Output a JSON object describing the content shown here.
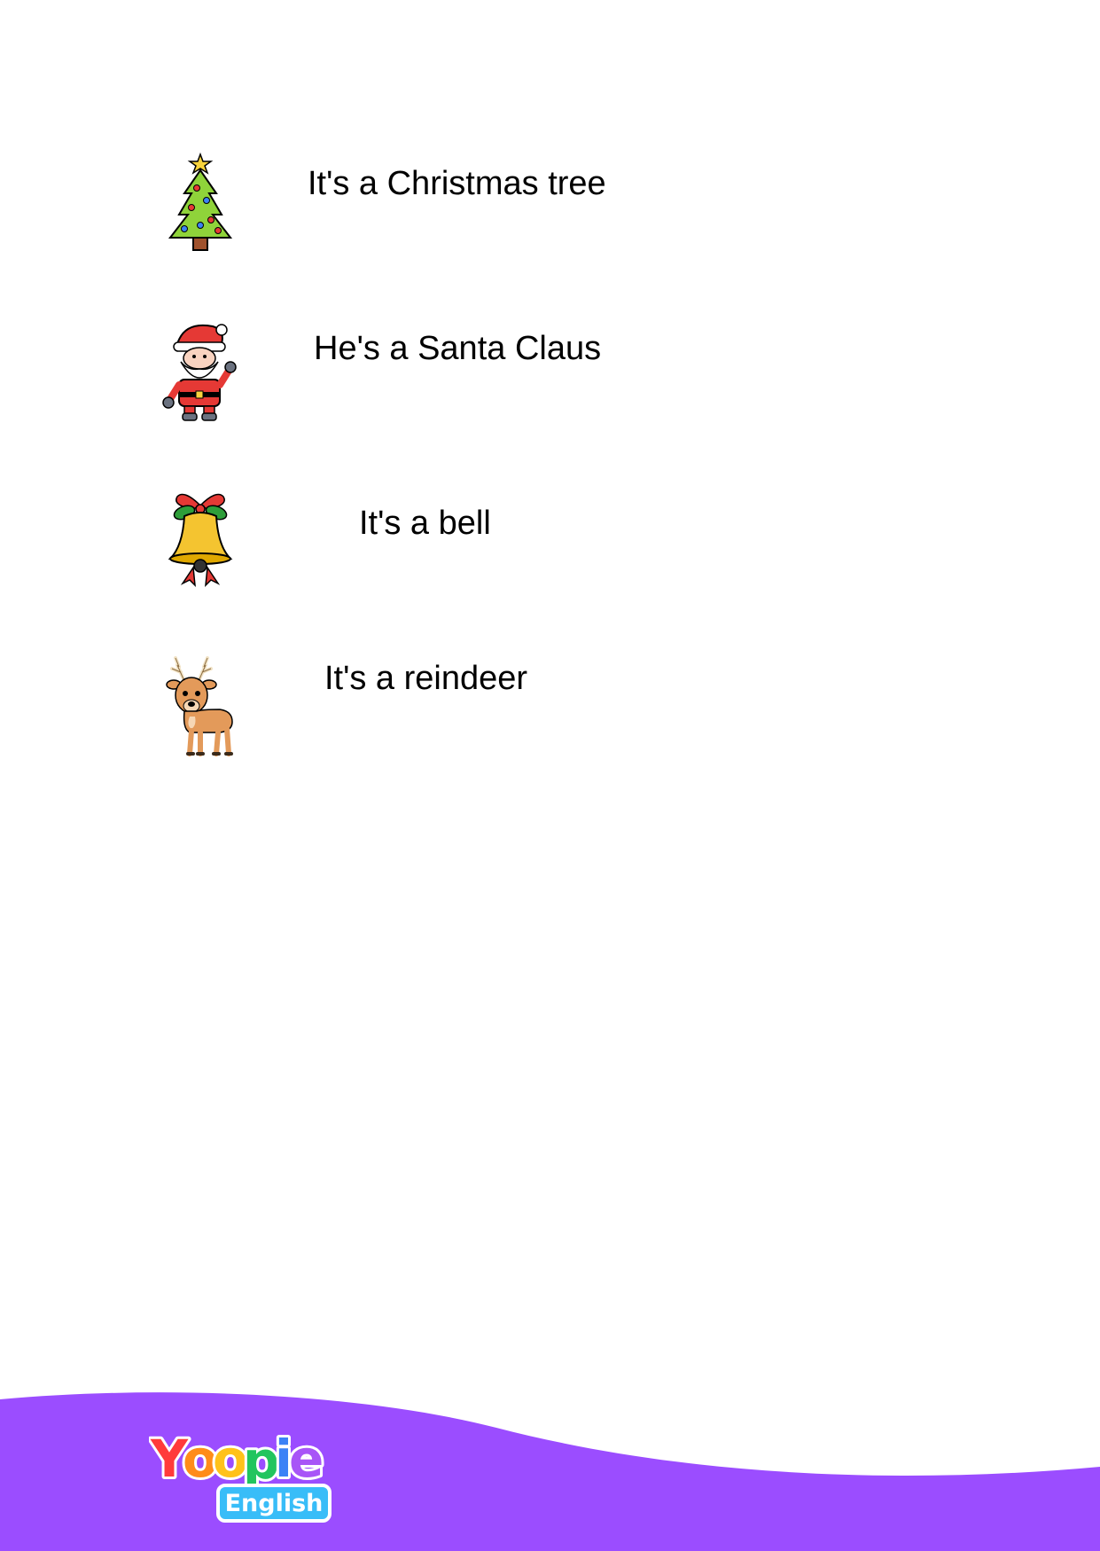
{
  "items": [
    {
      "sentence": "It's a Christmas tree",
      "icon": "christmas-tree-icon"
    },
    {
      "sentence": "He's a Santa Claus",
      "icon": "santa-claus-icon"
    },
    {
      "sentence": "It's a bell",
      "icon": "bell-icon"
    },
    {
      "sentence": "It's a reindeer",
      "icon": "reindeer-icon"
    }
  ],
  "footer": {
    "brand_word": "Yoopie",
    "brand_sub": "English",
    "band_color": "#9b4dff"
  }
}
